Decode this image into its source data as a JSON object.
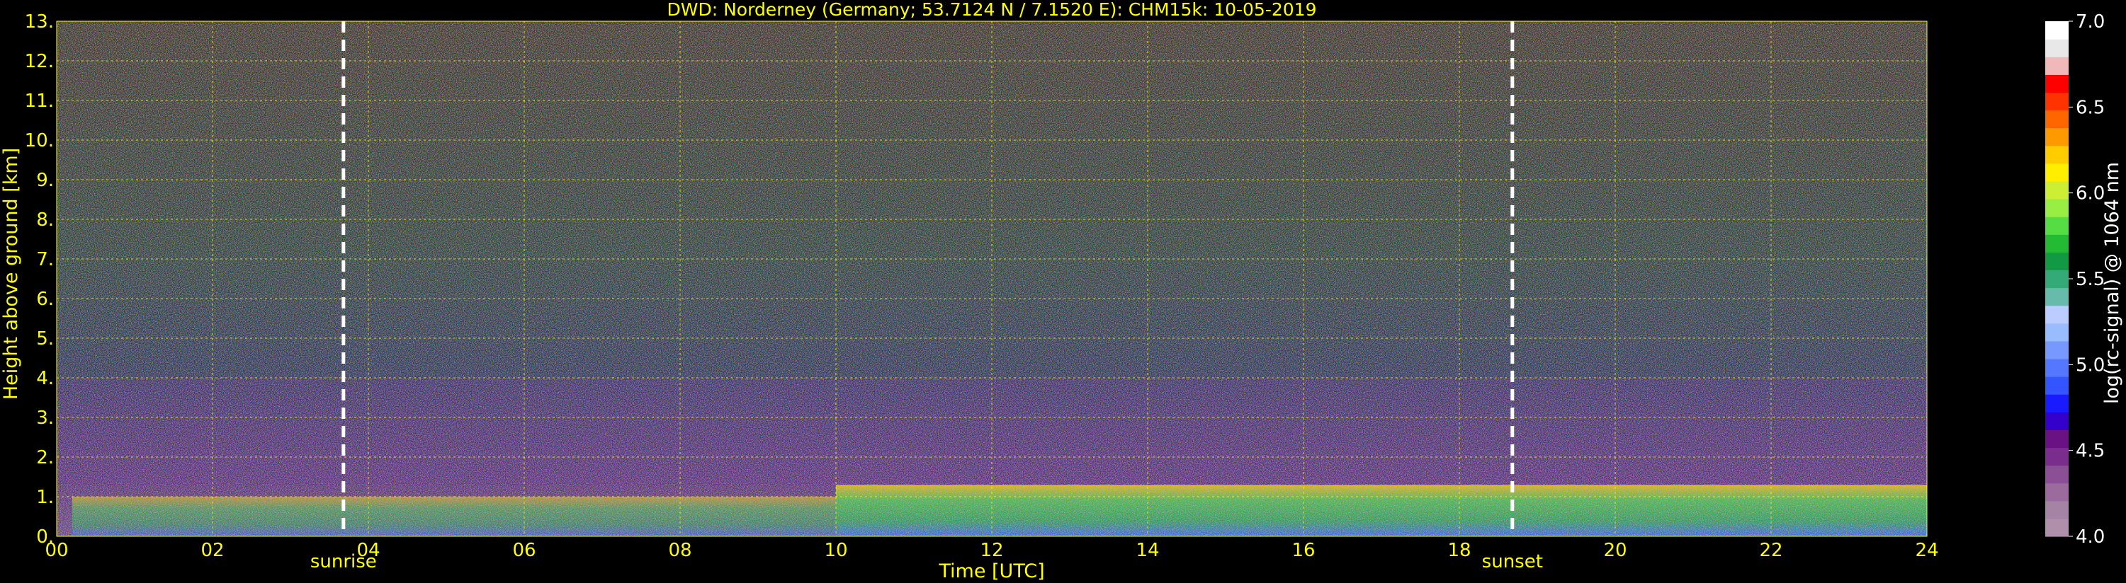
{
  "chart_data": {
    "type": "heatmap",
    "title": "DWD: Norderney (Germany; 53.7124 N / 7.1520 E):    CHM15k: 10-05-2019",
    "xlabel": "Time [UTC]",
    "ylabel": "Height above ground [km]",
    "xlim": [
      0,
      24
    ],
    "ylim": [
      0,
      13
    ],
    "x_ticks": [
      "00",
      "02",
      "04",
      "06",
      "08",
      "10",
      "12",
      "14",
      "16",
      "18",
      "20",
      "22",
      "24"
    ],
    "y_ticks": [
      "0.",
      "1.",
      "2.",
      "3.",
      "4.",
      "5.",
      "6.",
      "7.",
      "8.",
      "9.",
      "10.",
      "11.",
      "12.",
      "13."
    ],
    "grid": true,
    "markers": [
      {
        "label": "sunrise",
        "x": 3.68
      },
      {
        "label": "sunset",
        "x": 18.68
      }
    ],
    "colorbar": {
      "label": "log(rc-signal) @ 1064 nm",
      "range": [
        4.0,
        7.0
      ],
      "ticks": [
        "4.0",
        "4.5",
        "5.0",
        "5.5",
        "6.0",
        "6.5",
        "7.0"
      ],
      "colors": [
        "#b08fab",
        "#a583a5",
        "#9a6b9c",
        "#8a4f94",
        "#7a2d8c",
        "#6a1184",
        "#3300cc",
        "#1a1aff",
        "#3355ff",
        "#5577ff",
        "#7799ff",
        "#99bbff",
        "#bbccff",
        "#66bbaa",
        "#33aa77",
        "#119944",
        "#22bb33",
        "#55dd44",
        "#99ee44",
        "#ccee33",
        "#ffee00",
        "#ffcc00",
        "#ff9900",
        "#ff6600",
        "#ff3300",
        "#ff0000",
        "#f0b8b8",
        "#e8e8e8",
        "#ffffff"
      ]
    },
    "background_layers": [
      {
        "name": "boundary-layer",
        "height_range": [
          0.0,
          1.3
        ],
        "dominant": "green-yellow"
      },
      {
        "name": "residual-noise",
        "height_range": [
          1.3,
          4.0
        ],
        "dominant": "purple-blue"
      },
      {
        "name": "free-troposphere-noise",
        "height_range": [
          4.0,
          13.0
        ],
        "dominant": "mixed-noise"
      }
    ]
  }
}
